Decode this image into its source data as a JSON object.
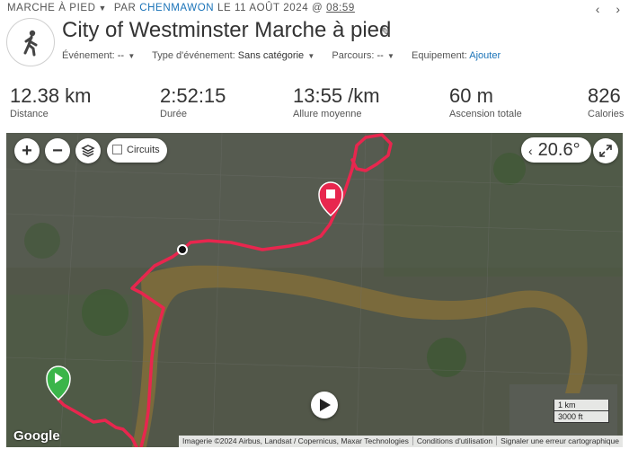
{
  "header": {
    "activity_type": "MARCHE À PIED",
    "by_label": "PAR",
    "owner": "CHENMAWON",
    "date_prefix": "LE 11 AOÛT 2024 @",
    "time": "08:59",
    "nav_prev": "‹",
    "nav_next": "›"
  },
  "activity": {
    "title": "City of Westminster Marche à pied",
    "icon": "walking-person-icon",
    "event_label": "Événement:",
    "event_value": "--",
    "event_type_label": "Type d'événement:",
    "event_type_value": "Sans catégorie",
    "course_label": "Parcours:",
    "course_value": "--",
    "equipment_label": "Equipement:",
    "equipment_link": "Ajouter"
  },
  "stats": [
    {
      "value": "12.38 km",
      "label": "Distance"
    },
    {
      "value": "2:52:15",
      "label": "Durée"
    },
    {
      "value": "13:55 /km",
      "label": "Allure moyenne"
    },
    {
      "value": "60 m",
      "label": "Ascension totale"
    },
    {
      "value": "826",
      "label": "Calories"
    }
  ],
  "map": {
    "zoom_in": "+",
    "zoom_out": "−",
    "circuits_label": "Circuits",
    "circuits_checked": false,
    "angle": "20.6°",
    "scale_km": "1 km",
    "scale_ft": "3000 ft",
    "google_logo": "Google",
    "attribution": [
      "Imagerie ©2024 Airbus, Landsat / Copernicus, Maxar Technologies",
      "Conditions d'utilisation",
      "Signaler une erreur cartographique"
    ],
    "route_color": "#e8264e",
    "start_marker_color": "#3bb54a",
    "end_marker_color": "#e8264e"
  }
}
